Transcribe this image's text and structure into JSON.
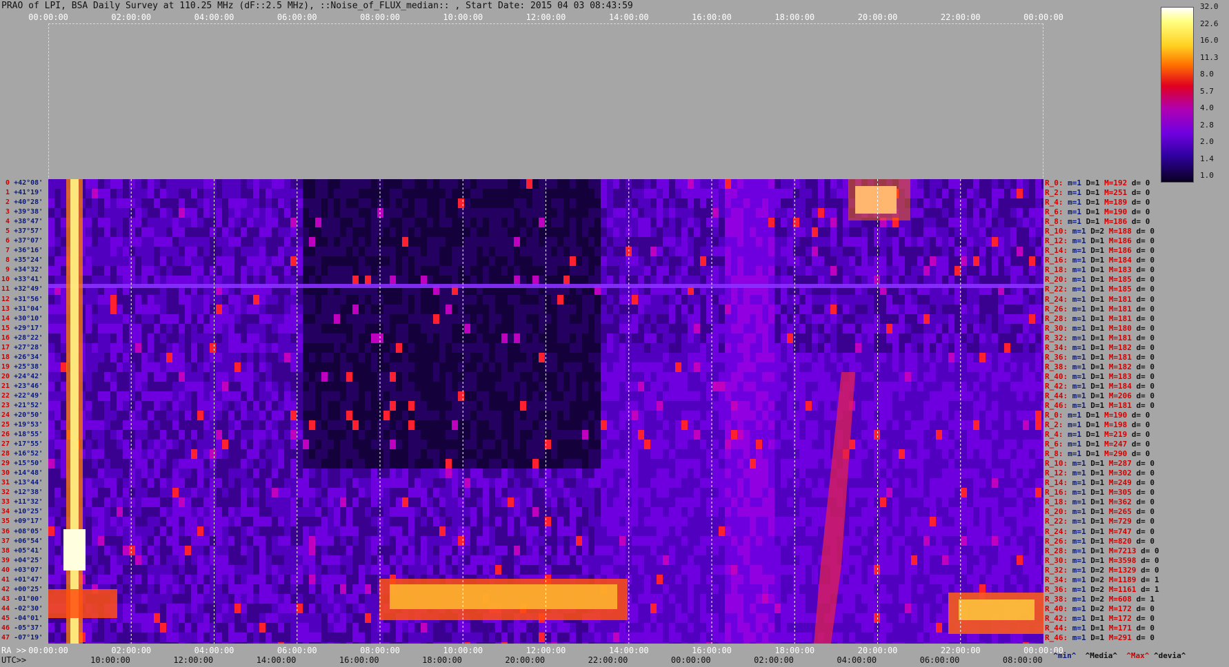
{
  "title": "PRAO of LPI, BSA Daily Survey at 110.25 MHz (dF::2.5 MHz), ::Noise_of_FLUX_median:: , Start Date: 2015 04 03 08:43:59",
  "top_axis": [
    "00:00:00",
    "02:00:00",
    "04:00:00",
    "06:00:00",
    "08:00:00",
    "10:00:00",
    "12:00:00",
    "14:00:00",
    "16:00:00",
    "18:00:00",
    "20:00:00",
    "22:00:00",
    "00:00:00"
  ],
  "ra_label": "RA >>",
  "ra_axis": [
    "00:00:00",
    "02:00:00",
    "04:00:00",
    "06:00:00",
    "08:00:00",
    "10:00:00",
    "12:00:00",
    "14:00:00",
    "16:00:00",
    "18:00:00",
    "20:00:00",
    "22:00:00",
    "00:00:00"
  ],
  "utc_label": "UTC>>",
  "utc_axis": [
    "10:00:00",
    "12:00:00",
    "14:00:00",
    "16:00:00",
    "18:00:00",
    "20:00:00",
    "22:00:00",
    "00:00:00",
    "02:00:00",
    "04:00:00",
    "06:00:00",
    "08:00:00"
  ],
  "declinations": [
    "+42°08'",
    "+41°19'",
    "+40°28'",
    "+39°38'",
    "+38°47'",
    "+37°57'",
    "+37°07'",
    "+36°16'",
    "+35°24'",
    "+34°32'",
    "+33°41'",
    "+32°49'",
    "+31°56'",
    "+31°04'",
    "+30°10'",
    "+29°17'",
    "+28°22'",
    "+27°28'",
    "+26°34'",
    "+25°38'",
    "+24°42'",
    "+23°46'",
    "+22°49'",
    "+21°52'",
    "+20°50'",
    "+19°53'",
    "+18°55'",
    "+17°55'",
    "+16°52'",
    "+15°50'",
    "+14°48'",
    "+13°44'",
    "+12°38'",
    "+11°32'",
    "+10°25'",
    "+09°17'",
    "+08°05'",
    "+06°54'",
    "+05°41'",
    "+04°25'",
    "+03°07'",
    "+01°47'",
    "+00°25'",
    "-01°00'",
    "-02°30'",
    "-04°01'",
    "-05°37'",
    "-07°19'"
  ],
  "stats": [
    {
      "r": "R_0:",
      "m": "1",
      "D": "1",
      "M": "192",
      "d": "0"
    },
    {
      "r": "R_2:",
      "m": "1",
      "D": "1",
      "M": "251",
      "d": "0"
    },
    {
      "r": "R_4:",
      "m": "1",
      "D": "1",
      "M": "189",
      "d": "0"
    },
    {
      "r": "R_6:",
      "m": "1",
      "D": "1",
      "M": "190",
      "d": "0"
    },
    {
      "r": "R_8:",
      "m": "1",
      "D": "1",
      "M": "186",
      "d": "0"
    },
    {
      "r": "R_10:",
      "m": "1",
      "D": "2",
      "M": "188",
      "d": "0"
    },
    {
      "r": "R_12:",
      "m": "1",
      "D": "1",
      "M": "186",
      "d": "0"
    },
    {
      "r": "R_14:",
      "m": "1",
      "D": "1",
      "M": "186",
      "d": "0"
    },
    {
      "r": "R_16:",
      "m": "1",
      "D": "1",
      "M": "184",
      "d": "0"
    },
    {
      "r": "R_18:",
      "m": "1",
      "D": "1",
      "M": "183",
      "d": "0"
    },
    {
      "r": "R_20:",
      "m": "1",
      "D": "1",
      "M": "185",
      "d": "0"
    },
    {
      "r": "R_22:",
      "m": "1",
      "D": "1",
      "M": "185",
      "d": "0"
    },
    {
      "r": "R_24:",
      "m": "1",
      "D": "1",
      "M": "181",
      "d": "0"
    },
    {
      "r": "R_26:",
      "m": "1",
      "D": "1",
      "M": "181",
      "d": "0"
    },
    {
      "r": "R_28:",
      "m": "1",
      "D": "1",
      "M": "181",
      "d": "0"
    },
    {
      "r": "R_30:",
      "m": "1",
      "D": "1",
      "M": "180",
      "d": "0"
    },
    {
      "r": "R_32:",
      "m": "1",
      "D": "1",
      "M": "181",
      "d": "0"
    },
    {
      "r": "R_34:",
      "m": "1",
      "D": "1",
      "M": "182",
      "d": "0"
    },
    {
      "r": "R_36:",
      "m": "1",
      "D": "1",
      "M": "181",
      "d": "0"
    },
    {
      "r": "R_38:",
      "m": "1",
      "D": "1",
      "M": "182",
      "d": "0"
    },
    {
      "r": "R_40:",
      "m": "1",
      "D": "1",
      "M": "183",
      "d": "0"
    },
    {
      "r": "R_42:",
      "m": "1",
      "D": "1",
      "M": "184",
      "d": "0"
    },
    {
      "r": "R_44:",
      "m": "1",
      "D": "1",
      "M": "206",
      "d": "0"
    },
    {
      "r": "R_46:",
      "m": "1",
      "D": "1",
      "M": "181",
      "d": "0"
    },
    {
      "r": "R_0:",
      "m": "1",
      "D": "1",
      "M": "190",
      "d": "0"
    },
    {
      "r": "R_2:",
      "m": "1",
      "D": "1",
      "M": "198",
      "d": "0"
    },
    {
      "r": "R_4:",
      "m": "1",
      "D": "1",
      "M": "219",
      "d": "0"
    },
    {
      "r": "R_6:",
      "m": "1",
      "D": "1",
      "M": "247",
      "d": "0"
    },
    {
      "r": "R_8:",
      "m": "1",
      "D": "1",
      "M": "290",
      "d": "0"
    },
    {
      "r": "R_10:",
      "m": "1",
      "D": "1",
      "M": "287",
      "d": "0"
    },
    {
      "r": "R_12:",
      "m": "1",
      "D": "1",
      "M": "302",
      "d": "0"
    },
    {
      "r": "R_14:",
      "m": "1",
      "D": "1",
      "M": "249",
      "d": "0"
    },
    {
      "r": "R_16:",
      "m": "1",
      "D": "1",
      "M": "305",
      "d": "0"
    },
    {
      "r": "R_18:",
      "m": "1",
      "D": "1",
      "M": "362",
      "d": "0"
    },
    {
      "r": "R_20:",
      "m": "1",
      "D": "1",
      "M": "265",
      "d": "0"
    },
    {
      "r": "R_22:",
      "m": "1",
      "D": "1",
      "M": "729",
      "d": "0"
    },
    {
      "r": "R_24:",
      "m": "1",
      "D": "1",
      "M": "747",
      "d": "0"
    },
    {
      "r": "R_26:",
      "m": "1",
      "D": "1",
      "M": "820",
      "d": "0"
    },
    {
      "r": "R_28:",
      "m": "1",
      "D": "1",
      "M": "7213",
      "d": "0"
    },
    {
      "r": "R_30:",
      "m": "1",
      "D": "1",
      "M": "3598",
      "d": "0"
    },
    {
      "r": "R_32:",
      "m": "1",
      "D": "2",
      "M": "1329",
      "d": "0"
    },
    {
      "r": "R_34:",
      "m": "1",
      "D": "2",
      "M": "1189",
      "d": "1"
    },
    {
      "r": "R_36:",
      "m": "1",
      "D": "2",
      "M": "1161",
      "d": "1"
    },
    {
      "r": "R_38:",
      "m": "1",
      "D": "2",
      "M": "608",
      "d": "1"
    },
    {
      "r": "R_40:",
      "m": "1",
      "D": "2",
      "M": "172",
      "d": "0"
    },
    {
      "r": "R_42:",
      "m": "1",
      "D": "1",
      "M": "172",
      "d": "0"
    },
    {
      "r": "R_44:",
      "m": "1",
      "D": "1",
      "M": "171",
      "d": "0"
    },
    {
      "r": "R_46:",
      "m": "1",
      "D": "1",
      "M": "291",
      "d": "0"
    }
  ],
  "legend": {
    "min": "^min^",
    "median": "^Media^",
    "max": "^Max^",
    "dev": "^devia^"
  },
  "colorbar_labels": [
    "32.0",
    "22.6",
    "16.0",
    "11.3",
    "8.0",
    "5.7",
    "4.0",
    "2.8",
    "2.0",
    "1.4",
    "1.0"
  ],
  "colors": {
    "background": "#a6a6a6",
    "low": "#0a0020",
    "mid": "#6a00d0",
    "high": "#ff2000",
    "peak": "#ffffe0"
  }
}
